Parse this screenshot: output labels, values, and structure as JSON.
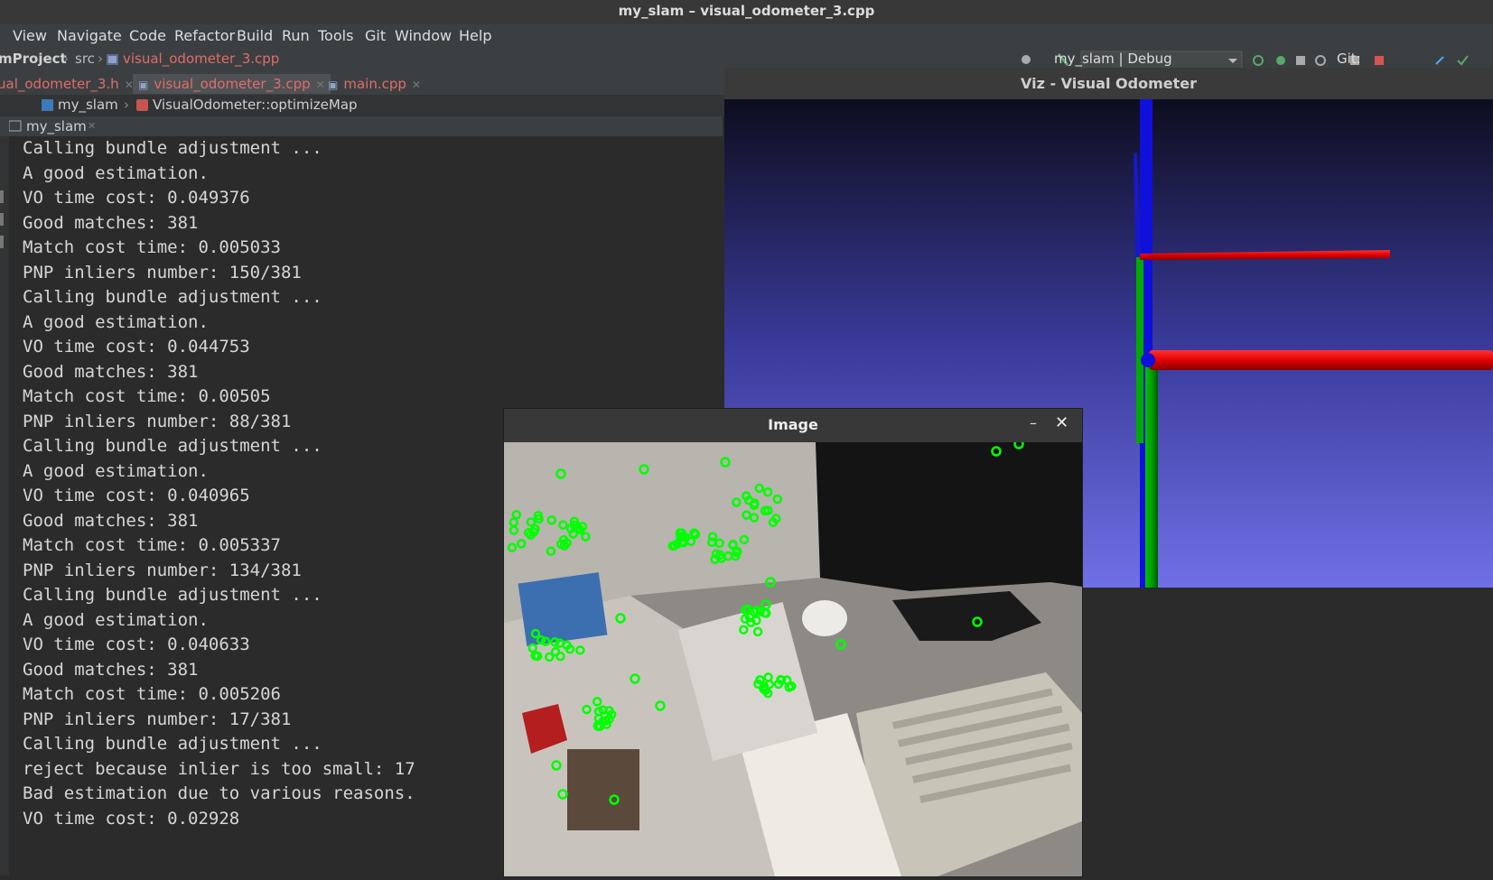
{
  "window": {
    "title": "my_slam – visual_odometer_3.cpp"
  },
  "menu": [
    "View",
    "Navigate",
    "Code",
    "Refactor",
    "Build",
    "Run",
    "Tools",
    "Git",
    "Window",
    "Help"
  ],
  "breadcrumb": {
    "project": "mProject",
    "folder": "src",
    "file": "visual_odometer_3.cpp"
  },
  "toolbar": {
    "run_config": "my_slam | Debug",
    "git_label": "Git:"
  },
  "tabs": [
    {
      "label": "ual_odometer_3.h"
    },
    {
      "label": "visual_odometer_3.cpp"
    },
    {
      "label": "main.cpp"
    }
  ],
  "nav": {
    "module": "my_slam",
    "function": "VisualOdometer::optimizeMap"
  },
  "run_tab": {
    "label": "my_slam"
  },
  "console": [
    "Calling bundle adjustment ...",
    "A good estimation.",
    "VO time cost: 0.049376",
    "Good matches: 381",
    "Match cost time: 0.005033",
    "PNP inliers number: 150/381",
    "Calling bundle adjustment ...",
    "A good estimation.",
    "VO time cost: 0.044753",
    "Good matches: 381",
    "Match cost time: 0.00505",
    "PNP inliers number: 88/381",
    "Calling bundle adjustment ...",
    "A good estimation.",
    "VO time cost: 0.040965",
    "Good matches: 381",
    "Match cost time: 0.005337",
    "PNP inliers number: 134/381",
    "Calling bundle adjustment ...",
    "A good estimation.",
    "VO time cost: 0.040633",
    "Good matches: 381",
    "Match cost time: 0.005206",
    "PNP inliers number: 17/381",
    "Calling bundle adjustment ...",
    "reject because inlier is too small: 17",
    "Bad estimation due to various reasons.",
    "VO time cost: 0.02928"
  ],
  "viz_window": {
    "title": "Viz - Visual Odometer"
  },
  "image_window": {
    "title": "Image",
    "minimize_glyph": "–",
    "close_glyph": "✕"
  },
  "colors": {
    "axis_x": "#e00000",
    "axis_y": "#00b000",
    "axis_z": "#0000dd",
    "keypoint": "#00ff00",
    "tab_red": "#e06c6c"
  }
}
